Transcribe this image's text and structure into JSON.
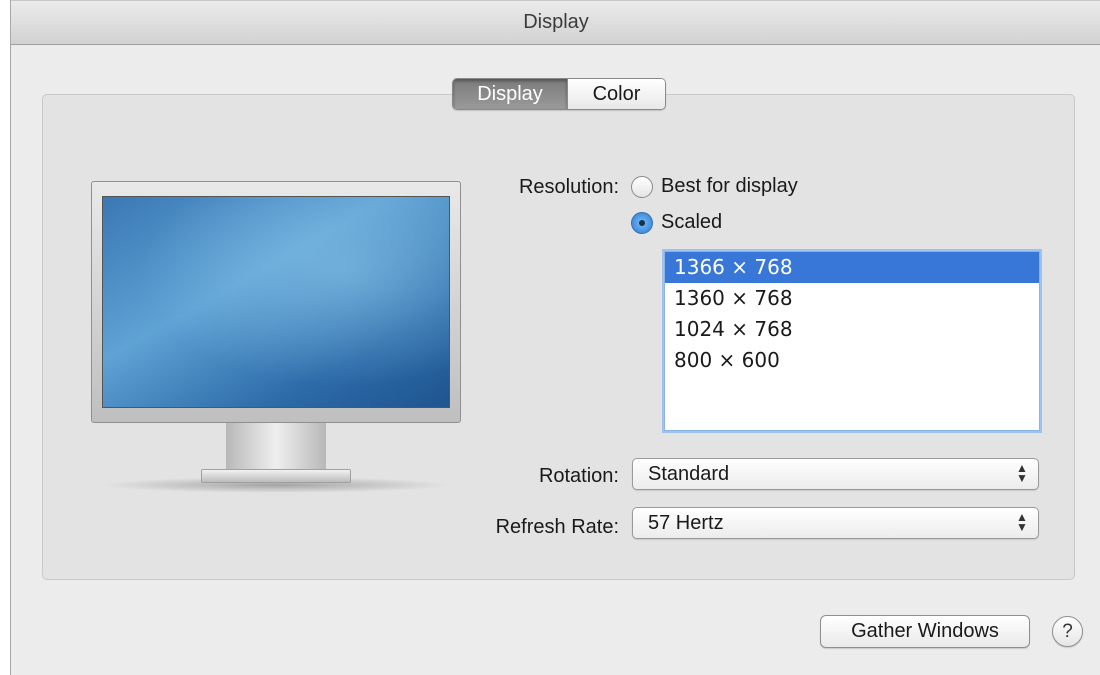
{
  "window": {
    "title": "Display"
  },
  "tabs": [
    {
      "label": "Display",
      "active": true
    },
    {
      "label": "Color",
      "active": false
    }
  ],
  "resolution": {
    "label": "Resolution:",
    "options": [
      {
        "label": "Best for display",
        "selected": false
      },
      {
        "label": "Scaled",
        "selected": true
      }
    ],
    "list": [
      "1366 × 768",
      "1360 × 768",
      "1024 × 768",
      "800 × 600"
    ],
    "selected_index": 0
  },
  "rotation": {
    "label": "Rotation:",
    "value": "Standard"
  },
  "refresh_rate": {
    "label": "Refresh Rate:",
    "value": "57 Hertz"
  },
  "footer": {
    "gather_label": "Gather Windows",
    "help_label": "?"
  },
  "colors": {
    "selection": "#3877d8",
    "focus_ring": "#9dc2ef"
  }
}
